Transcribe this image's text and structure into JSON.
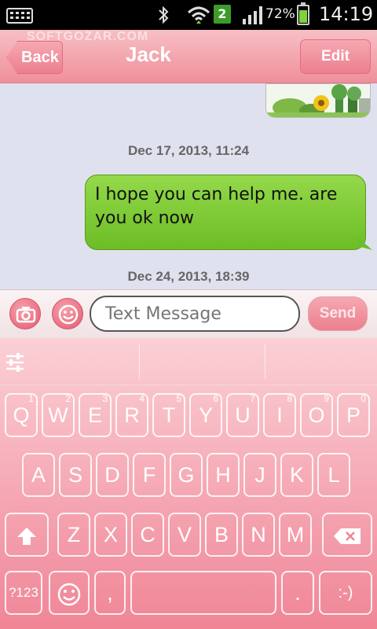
{
  "status_bar": {
    "notification_badge": "2",
    "battery_percent": "72%",
    "battery_level": 0.72,
    "time": "14:19",
    "icons": [
      "keyboard-icon",
      "bluetooth-icon",
      "wifi-icon",
      "signal-icon",
      "battery-icon"
    ]
  },
  "header": {
    "back_label": "Back",
    "title": "Jack",
    "edit_label": "Edit",
    "watermark": "SOFTGOZAR.COM"
  },
  "conversation": {
    "messages": [
      {
        "date": "Dec 17, 2013, 11:24",
        "text": "I hope you can help me. are you ok now"
      }
    ],
    "last_date": "Dec 24, 2013, 18:39"
  },
  "compose": {
    "placeholder": "Text Message",
    "send_label": "Send"
  },
  "keyboard": {
    "row1": [
      {
        "label": "Q",
        "sup": "1"
      },
      {
        "label": "W",
        "sup": "2"
      },
      {
        "label": "E",
        "sup": "3"
      },
      {
        "label": "R",
        "sup": "4"
      },
      {
        "label": "T",
        "sup": "5"
      },
      {
        "label": "Y",
        "sup": "6"
      },
      {
        "label": "U",
        "sup": "7"
      },
      {
        "label": "I",
        "sup": "8"
      },
      {
        "label": "O",
        "sup": "9"
      },
      {
        "label": "P",
        "sup": "0"
      }
    ],
    "row2": [
      "A",
      "S",
      "D",
      "F",
      "G",
      "H",
      "J",
      "K",
      "L"
    ],
    "row3": [
      "Z",
      "X",
      "C",
      "V",
      "B",
      "N",
      "M"
    ],
    "symbols_label": "?123",
    "comma_label": ",",
    "period_label": ".",
    "smiley_label": ":-)"
  },
  "colors": {
    "accent": "#ef8f9b",
    "bubble_green": "#7cc832",
    "keyboard_pink": "#f5a3ae"
  }
}
